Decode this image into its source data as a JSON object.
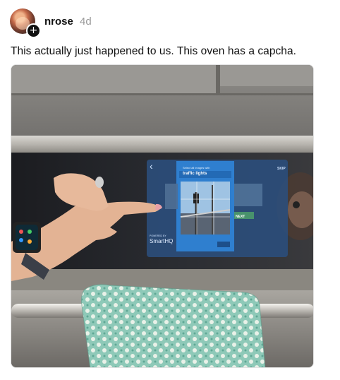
{
  "post": {
    "username": "nrose",
    "time_ago": "4d",
    "follow_icon": "plus-icon",
    "caption": "This actually just happened to us. This oven has a capcha."
  },
  "photo": {
    "oven_screen": {
      "back_glyph": "‹",
      "skip": "SKIP",
      "captcha_instruction": "Select all images with",
      "captcha_target": "traffic lights",
      "next": "NEXT",
      "brand_prefix": "POWERED BY",
      "brand": "SmartHQ"
    }
  }
}
